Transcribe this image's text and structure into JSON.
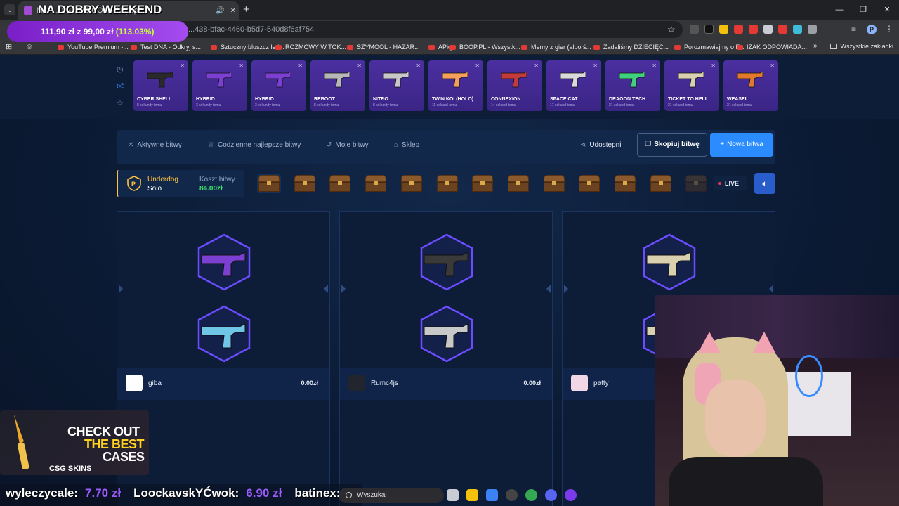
{
  "browser": {
    "tab_title": "M... ...D-SKINS.COM - Najlep...",
    "url": "...438-bfac-4460-b5d7-540d8f6af754",
    "bookmarks": [
      "YouTube Premium -...",
      "Test DNA - Odkryj s...",
      "Sztuczny bluszcz led...",
      "ROZMOWY W TOK...",
      "SZYMOOL - HAZAR...",
      "APiq",
      "BOOP.PL - Wszystk...",
      "Memy z gier (albo ś...",
      "Zadaliśmy DZIECIĘC...",
      "Porozmawiajmy o F...",
      "IZAK ODPOWIADA..."
    ],
    "all_bookmarks": "Wszystkie zakładki",
    "profile_initial": "P"
  },
  "stream": {
    "title": "NA DOBRY WEEKEND",
    "balance_text": "111,90 zł z 99,00 zł",
    "balance_pct": "(113.03%)",
    "ticker": [
      {
        "name": "wyleczycale:",
        "value": "7.70 zł"
      },
      {
        "name": "LoockavskYĆwok:",
        "value": "6.90 zł"
      },
      {
        "name": "batinex:",
        "value": "..."
      }
    ],
    "ad": {
      "l1": "CHECK OUT",
      "l2": "THE BEST",
      "l3": "CASES",
      "brand": "CSG SKINS"
    }
  },
  "live_drops": [
    {
      "name": "CYBER SHELL",
      "time": "8 sekundy temu",
      "color": "#2a2a2a"
    },
    {
      "name": "HYBRID",
      "time": "3 sekundy temu",
      "color": "#7b3fd1"
    },
    {
      "name": "HYBRID",
      "time": "3 sekundy temu",
      "color": "#7b3fd1"
    },
    {
      "name": "REBOOT",
      "time": "8 sekundy temu",
      "color": "#b7b7b7"
    },
    {
      "name": "NITRO",
      "time": "8 sekundy temu",
      "color": "#c8c8c8"
    },
    {
      "name": "TWIN KOI (HOLO)",
      "time": "11 sekund temu",
      "color": "#f5a05a"
    },
    {
      "name": "CONNEXION",
      "time": "14 sekund temu",
      "color": "#c23a3a"
    },
    {
      "name": "SPACE CAT",
      "time": "17 sekund temu",
      "color": "#d9d9d9"
    },
    {
      "name": "DRAGON TECH",
      "time": "21 sekund temu",
      "color": "#3fd17b"
    },
    {
      "name": "TICKET TO HELL",
      "time": "21 sekund temu",
      "color": "#d9d0b0"
    },
    {
      "name": "WEASEL",
      "time": "21 sekund temu",
      "color": "#e07a2a"
    }
  ],
  "nav": {
    "active_battles": "Aktywne bitwy",
    "daily_best": "Codzienne najlepsze bitwy",
    "my_battles": "Moje bitwy",
    "shop": "Sklep",
    "share": "Udostępnij",
    "copy": "Skopiuj bitwę",
    "new": "Nowa bitwa"
  },
  "battle": {
    "mode": "Underdog",
    "type": "Solo",
    "cost_label": "Koszt bitwy",
    "cost_value": "84.00zł",
    "chest_count": 13,
    "live": "LIVE"
  },
  "players": [
    {
      "name": "giba",
      "value": "0.00zł",
      "avatar_color": "#ffffff",
      "guns": [
        "#7b3fd1",
        "#6fc6e6"
      ]
    },
    {
      "name": "Rumc4js",
      "value": "0.00zł",
      "avatar_color": "#22252e",
      "guns": [
        "#3a3a3a",
        "#c8c8c8"
      ]
    },
    {
      "name": "patty",
      "value": "",
      "avatar_color": "#f1d7e6",
      "guns": [
        "#d9d0b0",
        "#d9d0b0"
      ]
    }
  ],
  "taskbar": {
    "search": "Wyszukaj"
  }
}
